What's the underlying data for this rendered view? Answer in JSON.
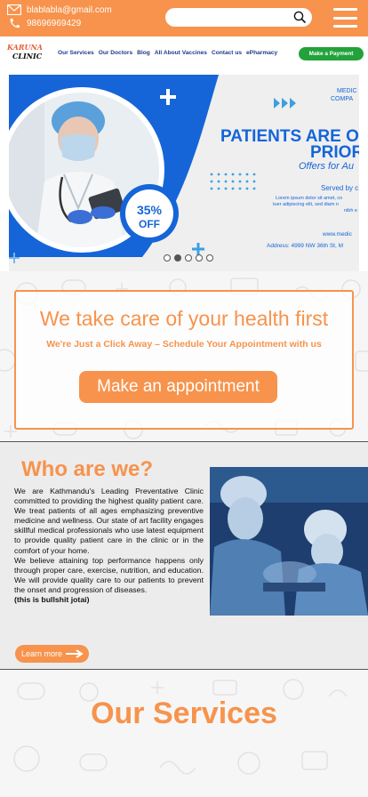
{
  "topbar": {
    "email": "blablabla@gmail.com",
    "phone": "98696969429",
    "search_placeholder": "",
    "accent": "#f7934c"
  },
  "nav": {
    "logo_top": "KARUNA",
    "logo_bottom": "CLINIC",
    "links": [
      "Our Services",
      "Our Doctors",
      "Blog",
      "All About Vaccines",
      "Contact us",
      "ePharmacy"
    ],
    "payment_button": "Make a Payment"
  },
  "banner": {
    "heading_line1": "PATIENTS ARE O",
    "heading_line2": "PRIOR",
    "offer": "Offers for Au",
    "corner": "MEDIC",
    "corner2": "COMPA",
    "served": "Served by c",
    "lorem1": "Lorem ipsum dolor sit amet, co",
    "lorem2": "tuer adipiscing elit, sed diam n",
    "lorem3": "nibh e",
    "website": "www.medic",
    "address": "Address: 4999 NW 36th St, M",
    "discount_value": "35%",
    "discount_label": "OFF",
    "dots": 5,
    "active_dot": 1
  },
  "appointment": {
    "title": "We take care of your health first",
    "subtitle": "We're Just a Click Away – Schedule Your Appointment with us",
    "button": "Make an appointment"
  },
  "who": {
    "title": "Who are we?",
    "paragraph1": "We are Kathmandu's Leading Preventative Clinic committed to providing the highest quality patient care. We treat patients of all ages emphasizing preventive medicine and wellness. Our state of art facility engages skillful medical professionals who use latest equipment to provide quality patient care in the clinic or in the comfort of your home.",
    "paragraph2": "We believe attaining top performance happens only through proper care, exercise, nutrition, and education. We will provide quality care to our patients to prevent the onset and progression of diseases.",
    "note": "(this is bullshit jotai)",
    "learn_more": "Learn more"
  },
  "services": {
    "title": "Our Services"
  },
  "colors": {
    "orange": "#f7934c",
    "green": "#23a23b",
    "navy": "#1e3a8a",
    "banner_blue": "#1565d8"
  }
}
